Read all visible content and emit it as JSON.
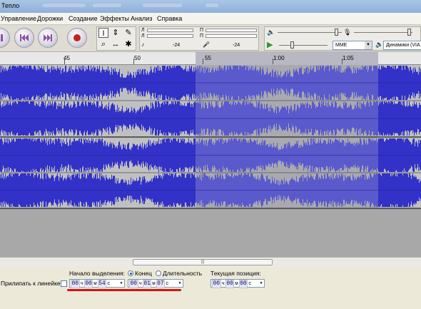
{
  "window": {
    "title": "Тепло"
  },
  "menu": {
    "items": [
      "Управление",
      "Дорожки",
      "Создание",
      "Эффекты",
      "Анализ",
      "Справка"
    ]
  },
  "toolbar": {
    "buttons": [
      "pause-icon",
      "skip-start-icon",
      "skip-end-icon",
      "record-icon"
    ]
  },
  "tools": [
    "selection-tool-icon",
    "envelope-tool-icon",
    "draw-tool-icon",
    "zoom-tool-icon",
    "timeshift-tool-icon",
    "multi-tool-icon"
  ],
  "meters": {
    "left_channel": "Л",
    "right_channel": "П",
    "db_value": "-24",
    "db_value_2": "-24"
  },
  "mixer": {
    "host": "MME",
    "output_device": "Динамики (VIA"
  },
  "ruler": {
    "labels": [
      "45",
      "50",
      "55",
      "1:00",
      "1:05"
    ]
  },
  "selection_toolbar": {
    "snap_label": "Прилипать к линейке",
    "selection_start_label": "Начало выделения:",
    "end_option": "Конец",
    "length_option": "Длительность",
    "position_label": "Текущая позиция:",
    "unit_h": "ч",
    "unit_m": "м",
    "unit_s": "с",
    "start_time": {
      "h": "00",
      "m": "00",
      "s": "54"
    },
    "end_time": {
      "h": "00",
      "m": "01",
      "s": "07"
    },
    "position_time": {
      "h": "00",
      "m": "00",
      "s": "00"
    }
  },
  "colors": {
    "waveform": "#3232c8",
    "waveform_selected": "#5a5acc",
    "selection_bg": "#a9a9b0",
    "track_bg": "#c0c0c0",
    "highlight_underline": "#d41414"
  }
}
